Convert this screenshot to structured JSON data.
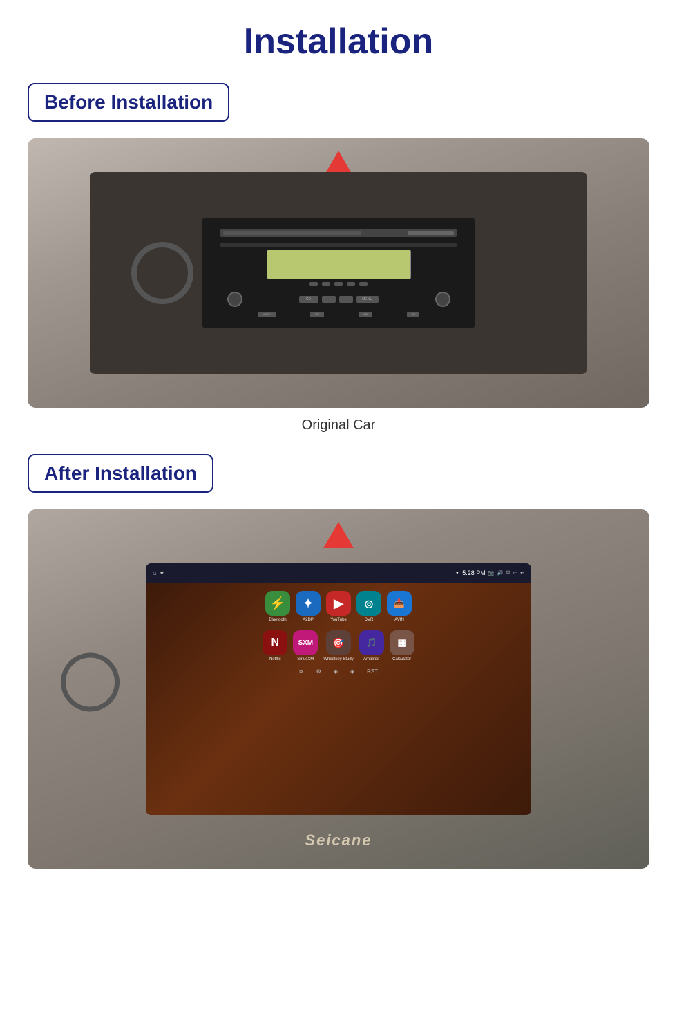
{
  "page": {
    "title": "Installation",
    "sections": [
      {
        "id": "before",
        "badge": "Before Installation",
        "caption": "Original Car"
      },
      {
        "id": "after",
        "badge": "After Installation",
        "caption": ""
      }
    ]
  },
  "after_apps_row1": [
    {
      "name": "Bluetooth",
      "bg": "bg-green",
      "icon": "⚡",
      "color": "#388e3c"
    },
    {
      "name": "A2DP",
      "bg": "bg-blue-dark",
      "icon": "✦",
      "color": "#1565c0"
    },
    {
      "name": "YouTube",
      "bg": "bg-red",
      "icon": "▶",
      "color": "#c62828"
    },
    {
      "name": "DVR",
      "bg": "bg-teal",
      "icon": "◎",
      "color": "#00838f"
    },
    {
      "name": "AVIN",
      "bg": "bg-blue-light",
      "icon": "🎬",
      "color": "#1976d2"
    }
  ],
  "after_apps_row2": [
    {
      "name": "Netflix",
      "bg": "bg-purple",
      "icon": "N",
      "color": "#6a1b9a"
    },
    {
      "name": "SiriusXM",
      "bg": "bg-pink",
      "icon": "S",
      "color": "#e91e63"
    },
    {
      "name": "Wheelkey Study",
      "bg": "bg-brown",
      "icon": "🎯",
      "color": "#5d4037"
    },
    {
      "name": "Amplifier",
      "bg": "bg-deep-purple",
      "icon": "🎵",
      "color": "#4527a0"
    },
    {
      "name": "Calculator",
      "bg": "bg-brown2",
      "icon": "▦",
      "color": "#795548"
    }
  ],
  "status_time": "5:28 PM",
  "seicane": "Seicane"
}
